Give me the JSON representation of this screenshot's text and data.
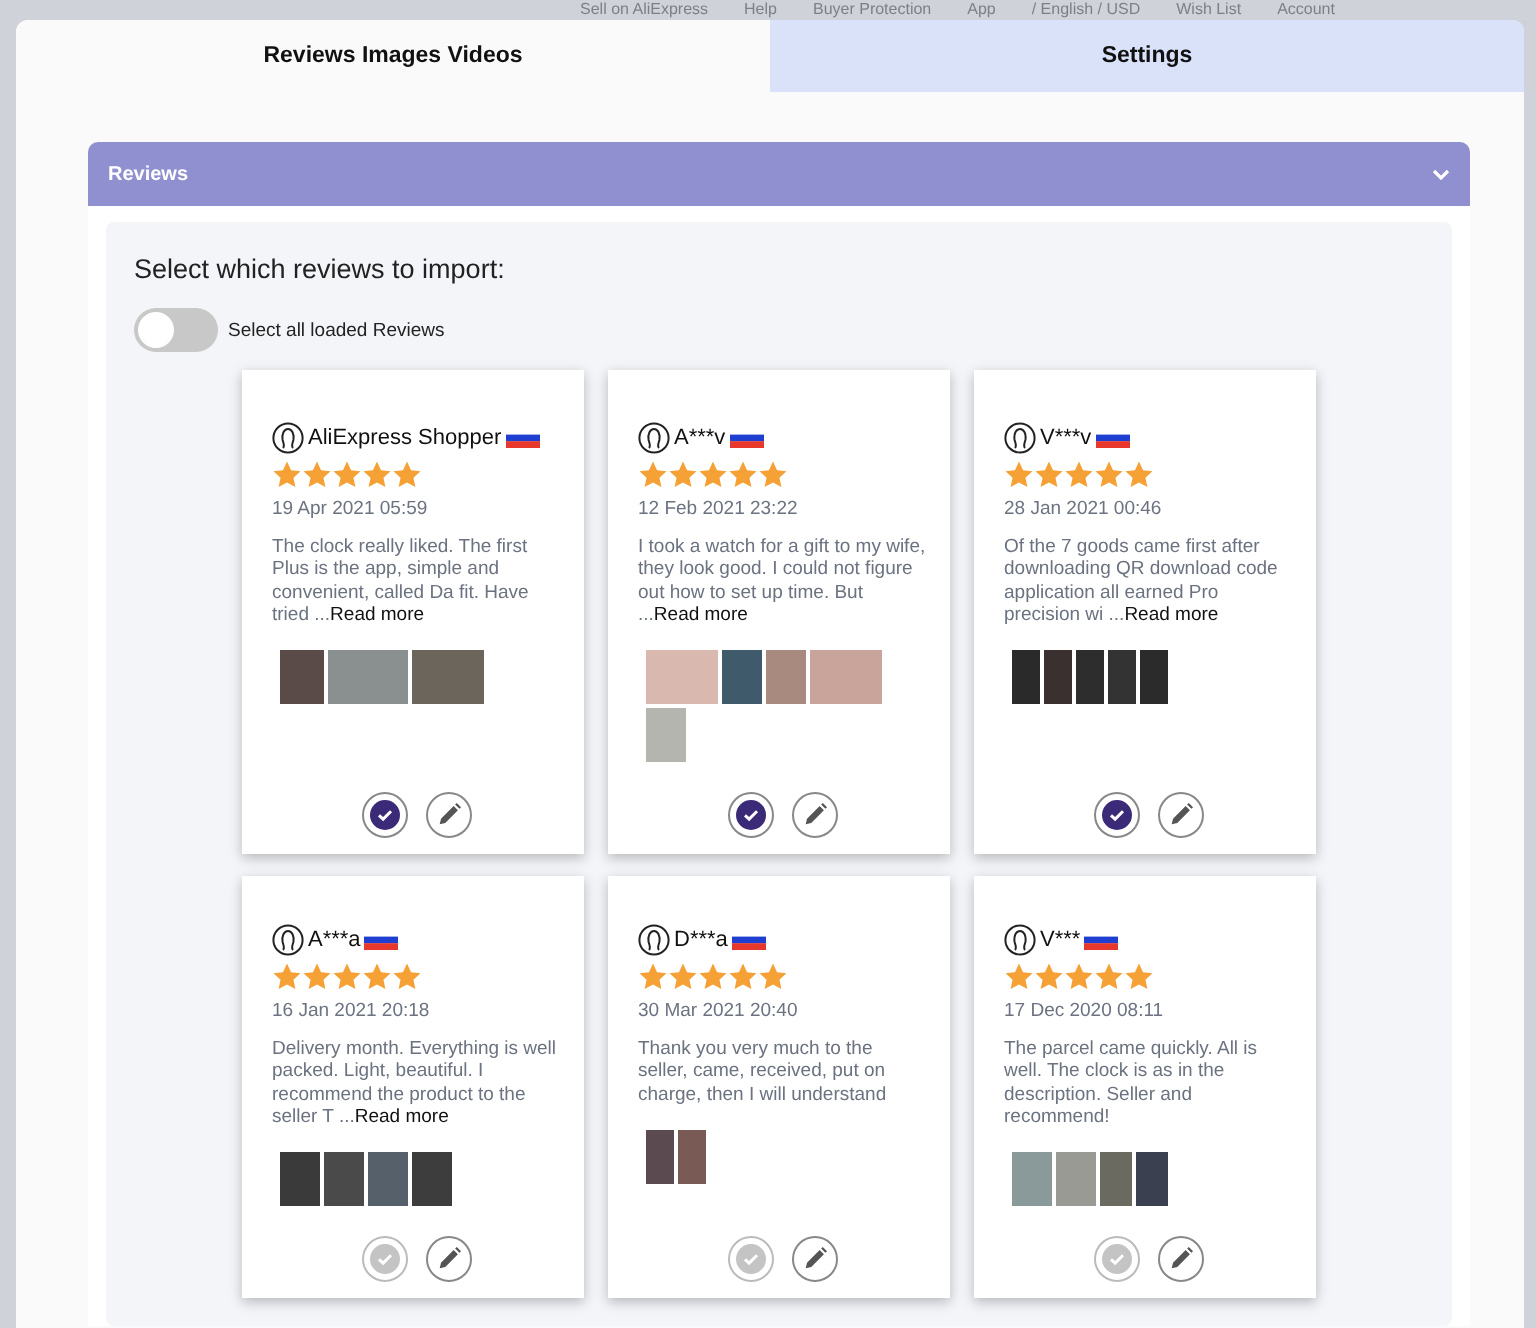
{
  "backdrop_header": {
    "items": [
      "Sell on AliExpress",
      "Help",
      "Buyer Protection",
      "App",
      "/ English / USD",
      "Wish List",
      "Account"
    ]
  },
  "tabs": [
    {
      "label": "Reviews Images Videos",
      "selected": true
    },
    {
      "label": "Settings",
      "selected": false
    }
  ],
  "panel": {
    "title": "Reviews",
    "expanded": true,
    "heading": "Select which reviews to import:",
    "select_all": {
      "label": "Select all loaded Reviews",
      "checked": false
    },
    "reviews": [
      {
        "author": "AliExpress Shopper",
        "stars": 5,
        "date": "19 Apr 2021 05:59",
        "text": "The clock really liked. The first Plus is the app, simple and convenient, called Da fit. Have tried ...",
        "read_more": "Read more",
        "selected": true
      },
      {
        "author": "A***v",
        "stars": 5,
        "date": "12 Feb 2021 23:22",
        "text": "I took a watch for a gift to my wife, they look good. I could not figure out how to set up time. But ...",
        "read_more": "Read more",
        "selected": true
      },
      {
        "author": "V***v",
        "stars": 5,
        "date": "28 Jan 2021 00:46",
        "text": "Of the 7 goods came first after downloading QR download code application all earned Pro precision wi ...",
        "read_more": "Read more",
        "selected": true
      },
      {
        "author": "A***a",
        "stars": 5,
        "date": "16 Jan 2021 20:18",
        "text": "Delivery month. Everything is well packed. Light, beautiful. I recommend the product to the seller T ...",
        "read_more": "Read more",
        "selected": false
      },
      {
        "author": "D***a",
        "stars": 5,
        "date": "30 Mar 2021 20:40",
        "text": "Thank you very much to the seller, came, received, put on charge, then I will understand",
        "selected": false
      },
      {
        "author": "V***",
        "stars": 5,
        "date": "17 Dec 2020 08:11",
        "text": "The parcel came quickly. All is well. The clock is as in the description. Seller and recommend!",
        "selected": false
      }
    ]
  }
}
